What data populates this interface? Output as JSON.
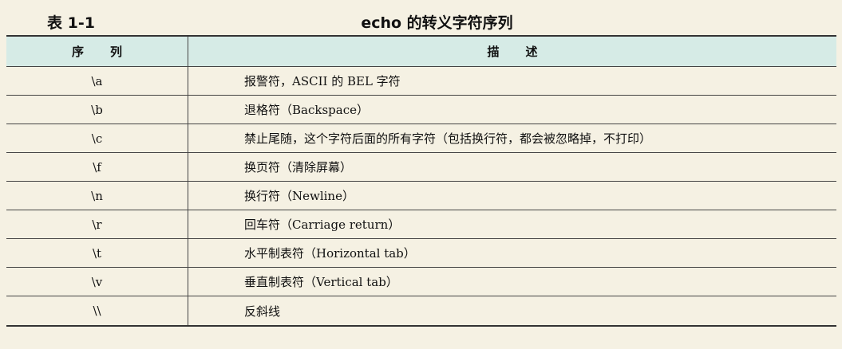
{
  "caption": {
    "label": "表 1-1",
    "title": "echo 的转义字符序列"
  },
  "table": {
    "headers": {
      "seq": "序列",
      "desc": "描述"
    },
    "rows": [
      {
        "seq": "\\a",
        "desc": "报警符，ASCII 的 BEL 字符"
      },
      {
        "seq": "\\b",
        "desc": "退格符（Backspace）"
      },
      {
        "seq": "\\c",
        "desc": "禁止尾随，这个字符后面的所有字符（包括换行符，都会被忽略掉，不打印）"
      },
      {
        "seq": "\\f",
        "desc": "换页符（清除屏幕）"
      },
      {
        "seq": "\\n",
        "desc": "换行符（Newline）"
      },
      {
        "seq": "\\r",
        "desc": "回车符（Carriage return）"
      },
      {
        "seq": "\\t",
        "desc": "水平制表符（Horizontal tab）"
      },
      {
        "seq": "\\v",
        "desc": "垂直制表符（Vertical tab）"
      },
      {
        "seq": "\\\\",
        "desc": "反斜线"
      }
    ]
  }
}
